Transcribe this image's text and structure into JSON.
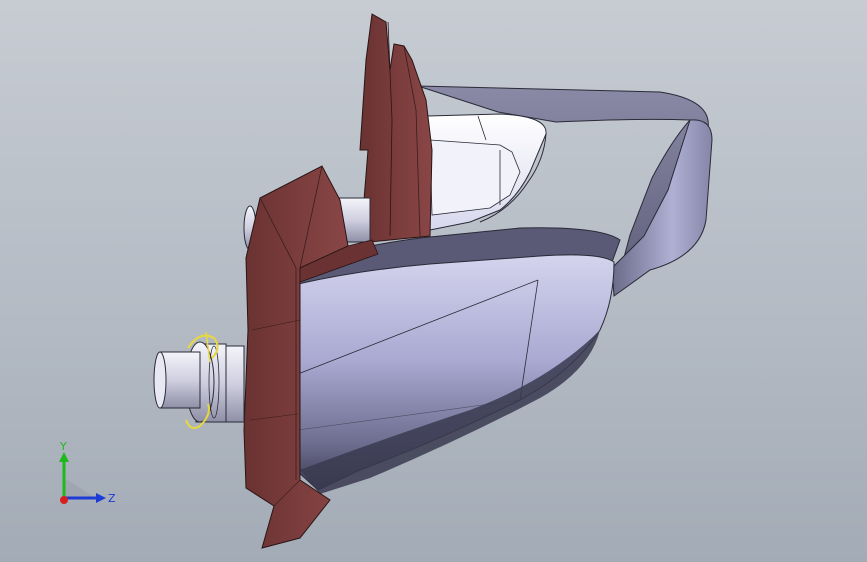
{
  "viewport": {
    "background_top": "#c7ccd3",
    "background_bottom": "#a3abb6"
  },
  "model": {
    "icon": "injector-nozzle-3d-model",
    "colors": {
      "body_light": "#c9c9e6",
      "body_mid": "#9d9dc8",
      "body_dark": "#4a4a66",
      "rim_top": "#7a7a96",
      "flange": "#7a3d3d",
      "flange_dark": "#5a2b2b",
      "connector": "#dcdce8",
      "wire": "#e8d840"
    }
  },
  "triad": {
    "y_label": "Y",
    "z_label": "Z",
    "colors": {
      "y_axis": "#1fb81f",
      "z_axis": "#1f3bd6",
      "x_axis": "#d61f1f"
    }
  }
}
